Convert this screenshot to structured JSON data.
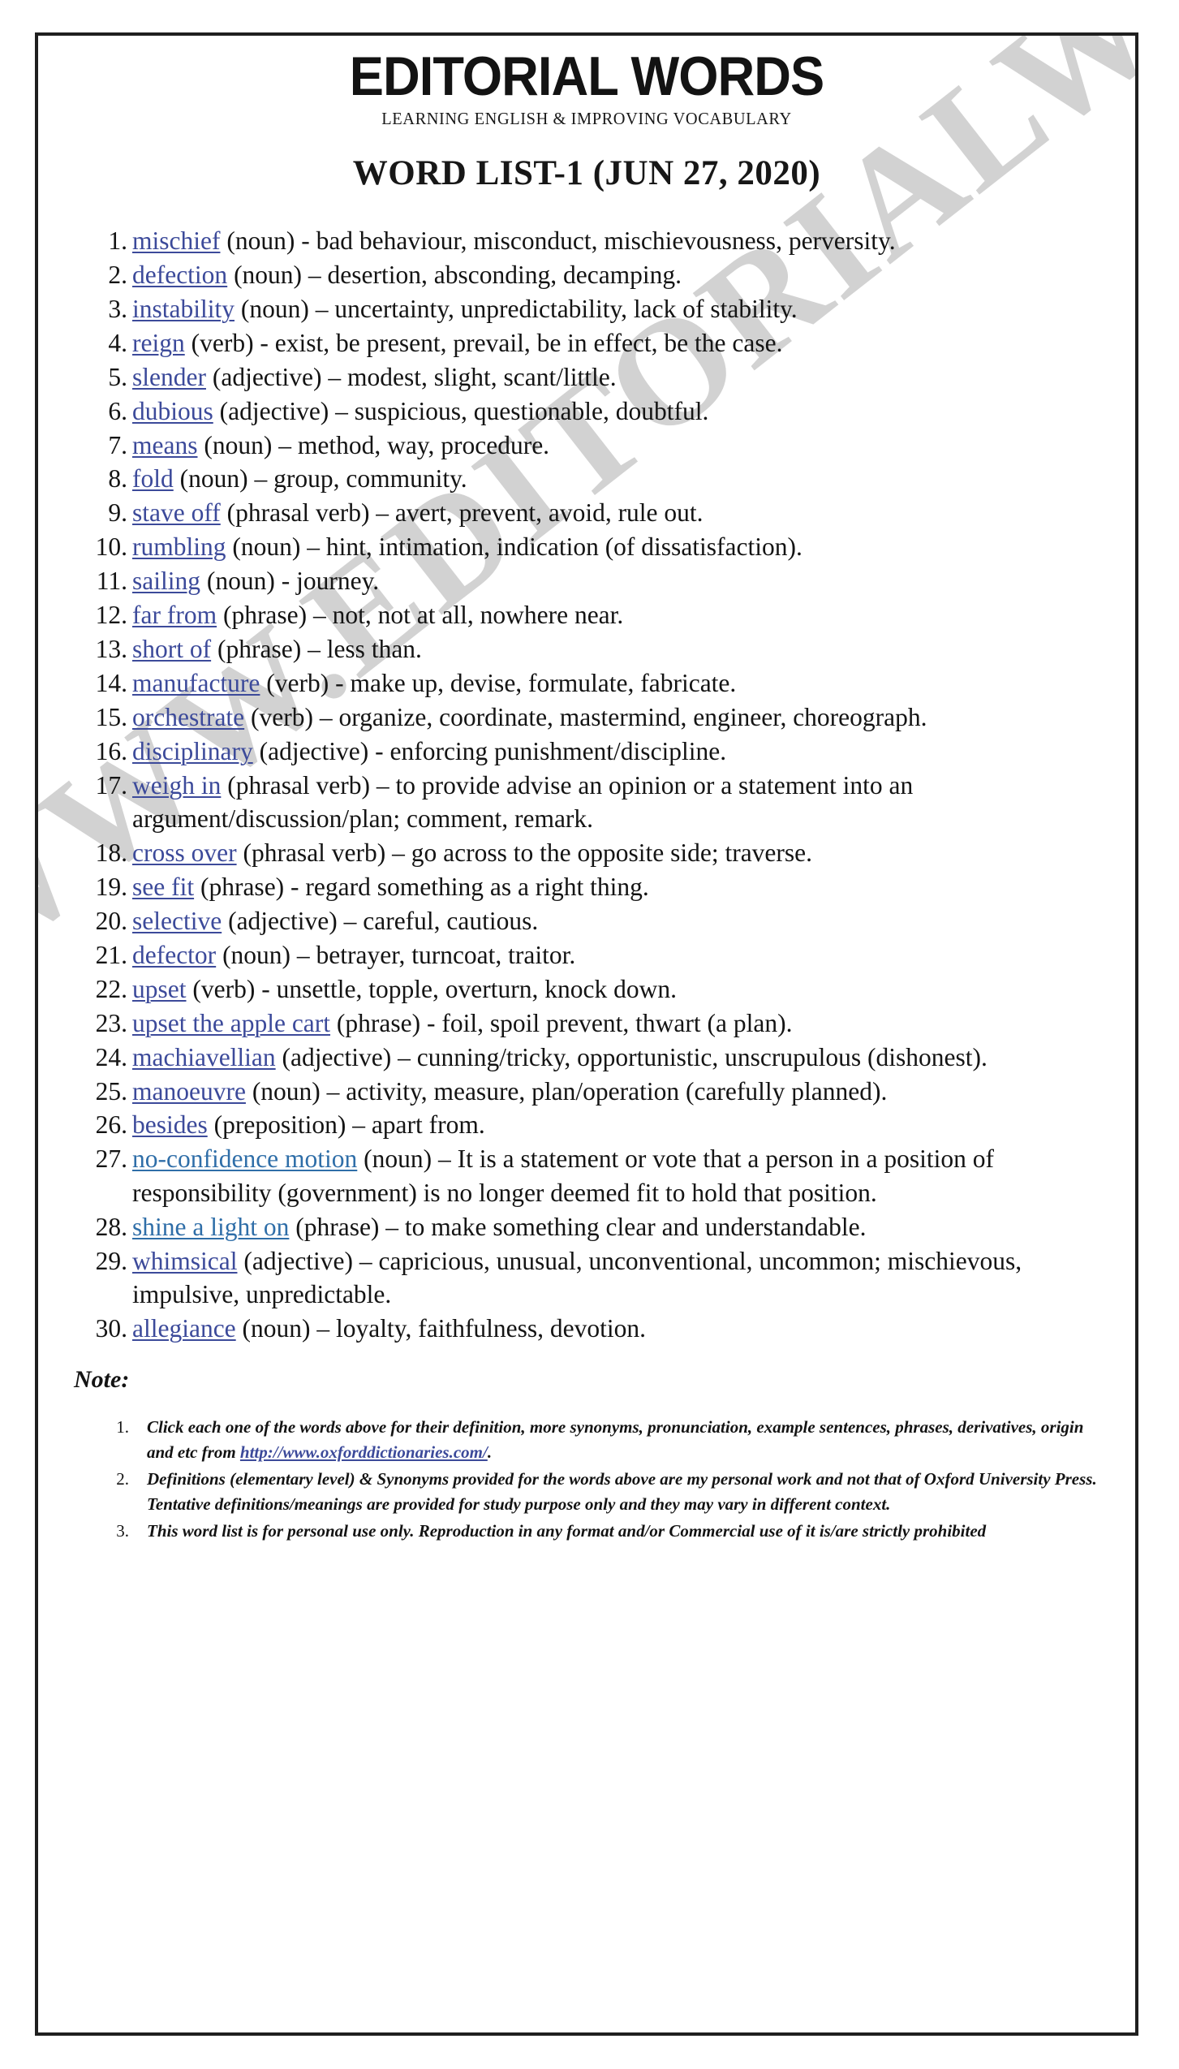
{
  "document": {
    "brand_title": "EDITORIAL WORDS",
    "brand_tagline": "LEARNING ENGLISH & IMPROVING VOCABULARY",
    "list_title": "WORD LIST-1 (JUN 27, 2020)",
    "watermark_text": "WWW.EDITORIALWORDS.COM",
    "link_color": "#3c4a9a",
    "link_color_alt": "#2f6ea8",
    "border_color": "#1f1f1f",
    "watermark_color": "#c9c9c9"
  },
  "words": [
    {
      "num": "1.",
      "term": "mischief",
      "definition": " (noun) - bad behaviour, misconduct, mischievousness, perversity."
    },
    {
      "num": "2.",
      "term": "defection",
      "definition": " (noun) – desertion, absconding, decamping."
    },
    {
      "num": "3.",
      "term": "instability",
      "definition": " (noun) – uncertainty, unpredictability, lack of stability."
    },
    {
      "num": "4.",
      "term": "reign",
      "definition": " (verb) - exist, be present, prevail, be in effect, be the case."
    },
    {
      "num": "5.",
      "term": "slender",
      "definition": " (adjective) – modest, slight, scant/little."
    },
    {
      "num": "6.",
      "term": "dubious",
      "definition": " (adjective) – suspicious, questionable, doubtful."
    },
    {
      "num": "7.",
      "term": "means",
      "definition": " (noun) – method, way, procedure."
    },
    {
      "num": "8.",
      "term": "fold",
      "definition": " (noun) – group, community."
    },
    {
      "num": "9.",
      "term": "stave off",
      "definition": " (phrasal verb) – avert, prevent, avoid, rule out."
    },
    {
      "num": "10.",
      "term": "rumbling",
      "definition": " (noun) – hint, intimation, indication (of dissatisfaction)."
    },
    {
      "num": "11.",
      "term": "sailing",
      "definition": " (noun) - journey."
    },
    {
      "num": "12.",
      "term": "far from",
      "definition": " (phrase) – not, not at all, nowhere near."
    },
    {
      "num": "13.",
      "term": "short of",
      "definition": " (phrase) – less than."
    },
    {
      "num": "14.",
      "term": "manufacture",
      "definition": " (verb) - make up, devise, formulate, fabricate."
    },
    {
      "num": "15.",
      "term": "orchestrate",
      "definition": " (verb) – organize, coordinate, mastermind, engineer, choreograph."
    },
    {
      "num": "16.",
      "term": "disciplinary",
      "definition": " (adjective) - enforcing punishment/discipline."
    },
    {
      "num": "17.",
      "term": "weigh in",
      "definition": " (phrasal verb) – to provide advise an opinion or a statement into an argument/discussion/plan; comment, remark."
    },
    {
      "num": "18.",
      "term": "cross over",
      "definition": " (phrasal verb) – go across to the opposite side; traverse."
    },
    {
      "num": "19.",
      "term": "see fit",
      "definition": " (phrase) - regard something as a right thing."
    },
    {
      "num": "20.",
      "term": "selective",
      "definition": " (adjective) – careful, cautious."
    },
    {
      "num": "21.",
      "term": "defector",
      "definition": " (noun) – betrayer, turncoat, traitor."
    },
    {
      "num": "22.",
      "term": "upset",
      "definition": " (verb) - unsettle, topple, overturn, knock down."
    },
    {
      "num": "23.",
      "term": "upset the apple cart",
      "definition": " (phrase) - foil, spoil prevent, thwart (a plan)."
    },
    {
      "num": "24.",
      "term": "machiavellian",
      "definition": " (adjective) – cunning/tricky, opportunistic, unscrupulous (dishonest)."
    },
    {
      "num": "25.",
      "term": "manoeuvre",
      "definition": " (noun) – activity, measure, plan/operation (carefully planned)."
    },
    {
      "num": "26.",
      "term": "besides",
      "definition": " (preposition) – apart from."
    },
    {
      "num": "27.",
      "term": "no-confidence motion",
      "definition": " (noun) – It is a statement or vote that a person in a position of responsibility (government) is no longer deemed fit to hold that position.",
      "alt_color": true
    },
    {
      "num": "28.",
      "term": "shine a light on",
      "definition": " (phrase) – to make something clear and understandable.",
      "alt_color": true
    },
    {
      "num": "29.",
      "term": "whimsical",
      "definition": " (adjective) – capricious, unusual, unconventional, uncommon; mischievous, impulsive, unpredictable."
    },
    {
      "num": "30.",
      "term": "allegiance",
      "definition": " (noun) – loyalty, faithfulness, devotion."
    }
  ],
  "note": {
    "heading": "Note:",
    "items": [
      {
        "num": "1.",
        "text_before": "Click each one of the words above for their definition, more synonyms, pronunciation, example sentences, phrases, derivatives, origin and etc from ",
        "link": "http://www.oxforddictionaries.com/",
        "text_after": "."
      },
      {
        "num": "2.",
        "text_before": "Definitions (elementary level) & Synonyms provided for the words above are my personal work and not that of Oxford University Press. Tentative definitions/meanings are provided for study purpose only and they may vary in different context.",
        "link": "",
        "text_after": ""
      },
      {
        "num": "3.",
        "text_before": "This word list is for personal use only. Reproduction in any format and/or Commercial use of it is/are strictly prohibited",
        "link": "",
        "text_after": ""
      }
    ]
  }
}
